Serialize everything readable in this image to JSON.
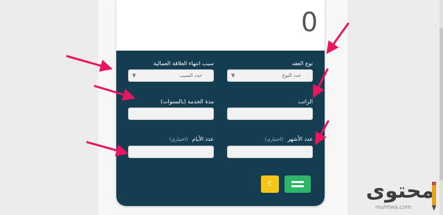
{
  "display": {
    "value": "0"
  },
  "form": {
    "contract_type": {
      "label": "نوع العقد",
      "placeholder": "حدد النوع"
    },
    "termination_reason": {
      "label": "سبب انتهاء العلاقة العمالية",
      "placeholder": "حدد السبب"
    },
    "salary": {
      "label": "الراتب"
    },
    "service_duration": {
      "label": "مدة الخدمة (بالسنوات)"
    },
    "months": {
      "label": "عدد الأشهر",
      "optional": "(اختياري)"
    },
    "days": {
      "label": "عدد الأيام",
      "optional": "(اختياري)"
    }
  },
  "buttons": {
    "clear_label": "C"
  },
  "logo": {
    "text": "محتوى",
    "url": "muhtwa.com"
  },
  "colors": {
    "panel": "#153d52",
    "clear_button": "#f5c518",
    "calculate_button": "#2db56a",
    "annotation_arrow": "#e8155f"
  },
  "icons": {
    "calculate_button": "equals-icon",
    "annotations": "arrow-icon"
  }
}
